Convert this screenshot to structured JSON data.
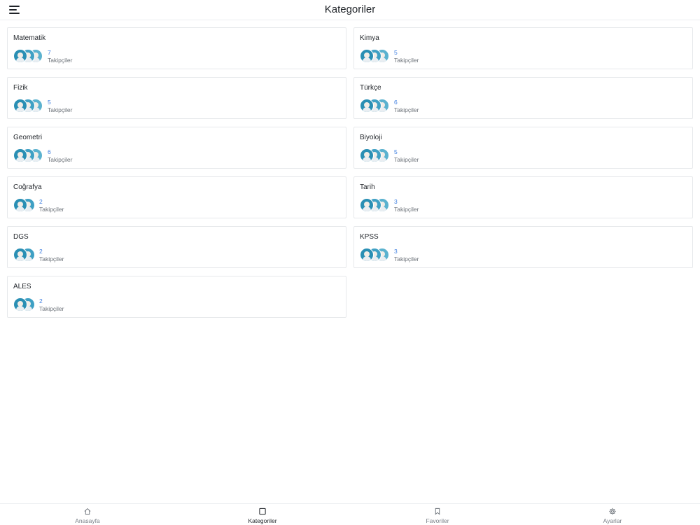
{
  "header": {
    "title": "Kategoriler",
    "menu_icon": "hamburger-icon"
  },
  "categories": [
    {
      "name": "Matematik",
      "count": "7",
      "followers_label": "Takipçiler",
      "avatars": 3
    },
    {
      "name": "Kimya",
      "count": "5",
      "followers_label": "Takipçiler",
      "avatars": 3
    },
    {
      "name": "Fizik",
      "count": "5",
      "followers_label": "Takipçiler",
      "avatars": 3
    },
    {
      "name": "Türkçe",
      "count": "6",
      "followers_label": "Takipçiler",
      "avatars": 3
    },
    {
      "name": "Geometri",
      "count": "6",
      "followers_label": "Takipçiler",
      "avatars": 3
    },
    {
      "name": "Biyoloji",
      "count": "5",
      "followers_label": "Takipçiler",
      "avatars": 3
    },
    {
      "name": "Coğrafya",
      "count": "2",
      "followers_label": "Takipçiler",
      "avatars": 2
    },
    {
      "name": "Tarih",
      "count": "3",
      "followers_label": "Takipçiler",
      "avatars": 3
    },
    {
      "name": "DGS",
      "count": "2",
      "followers_label": "Takipçiler",
      "avatars": 2
    },
    {
      "name": "KPSS",
      "count": "3",
      "followers_label": "Takipçiler",
      "avatars": 3
    },
    {
      "name": "ALES",
      "count": "2",
      "followers_label": "Takipçiler",
      "avatars": 2
    }
  ],
  "tabbar": {
    "items": [
      {
        "label": "Anasayfa",
        "icon": "home-icon",
        "active": false
      },
      {
        "label": "Kategoriler",
        "icon": "square-icon",
        "active": true
      },
      {
        "label": "Favoriler",
        "icon": "bookmark-icon",
        "active": false
      },
      {
        "label": "Ayarlar",
        "icon": "gear-icon",
        "active": false
      }
    ]
  },
  "colors": {
    "accent": "#3d7ee0",
    "text": "#1f2328",
    "muted": "#6b7178",
    "border": "#e6e8eb"
  }
}
